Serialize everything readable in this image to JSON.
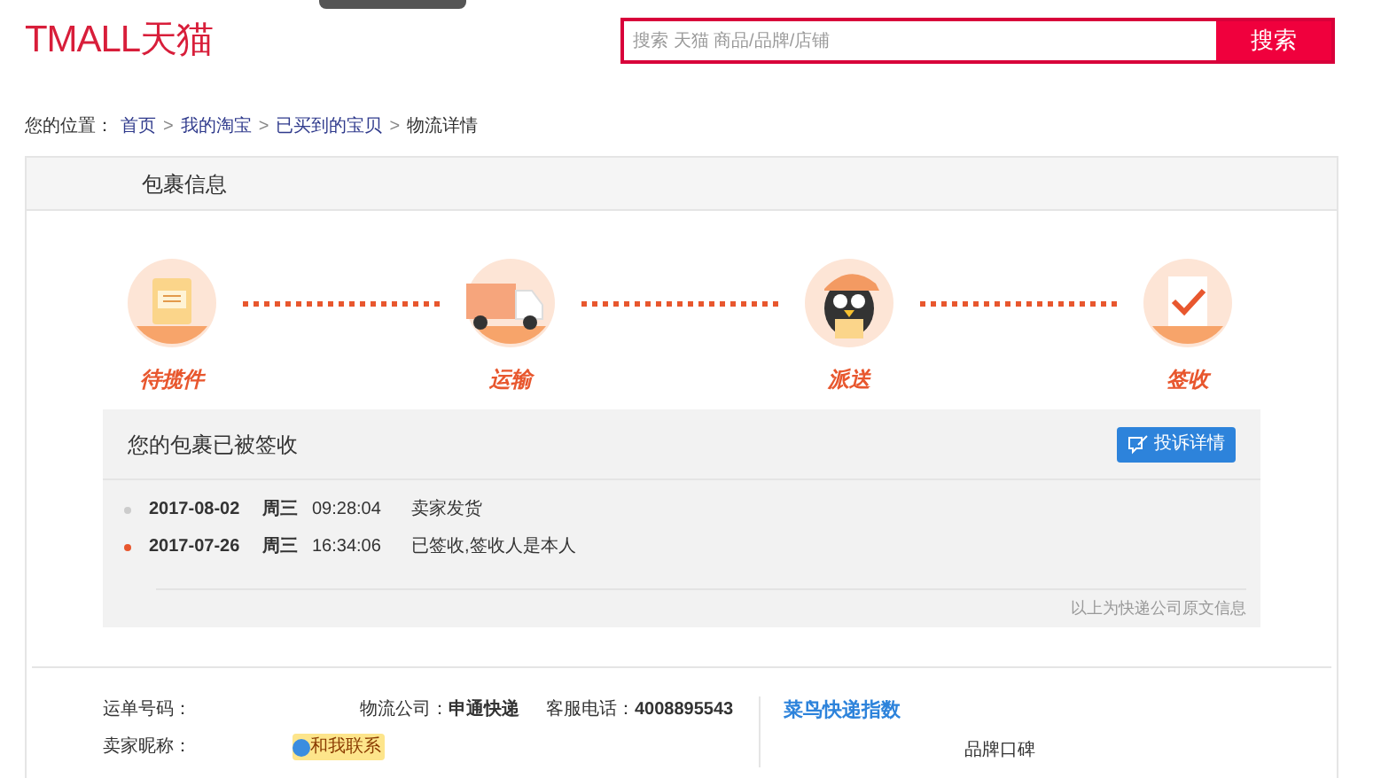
{
  "header": {
    "logo": "TMALL天猫",
    "search": {
      "placeholder": "搜索 天猫 商品/品牌/店铺"
    },
    "search_button": "搜索"
  },
  "breadcrumb": {
    "label": "您的位置：",
    "items": [
      {
        "text": "首页",
        "link": true
      },
      {
        "text": "我的淘宝",
        "link": true
      },
      {
        "text": "已买到的宝贝",
        "link": true
      },
      {
        "text": "物流详情",
        "link": false
      }
    ],
    "separator": ">"
  },
  "panel": {
    "title": "包裹信息",
    "steps": [
      {
        "label": "待揽件",
        "kind": "package"
      },
      {
        "label": "运输",
        "kind": "truck"
      },
      {
        "label": "派送",
        "kind": "courier"
      },
      {
        "label": "签收",
        "kind": "signed"
      }
    ],
    "status": {
      "title": "您的包裹已被签收",
      "button": "投诉详情",
      "events": [
        {
          "date": "2017-08-02",
          "weekday": "周三",
          "time": "09:28:04",
          "text": "卖家发货",
          "latest": false
        },
        {
          "date": "2017-07-26",
          "weekday": "周三",
          "time": "16:34:06",
          "text": "已签收,签收人是本人",
          "latest": true
        }
      ],
      "note": "以上为快递公司原文信息"
    },
    "info": {
      "waybill_label": "运单号码：",
      "company_label": "物流公司：",
      "company": "申通快递",
      "phone_label": "客服电话：",
      "phone": "4008895543",
      "seller_label": "卖家昵称：",
      "contact": "和我联系",
      "index_title": "菜鸟快递指数",
      "brand_label": "品牌口碑"
    }
  }
}
